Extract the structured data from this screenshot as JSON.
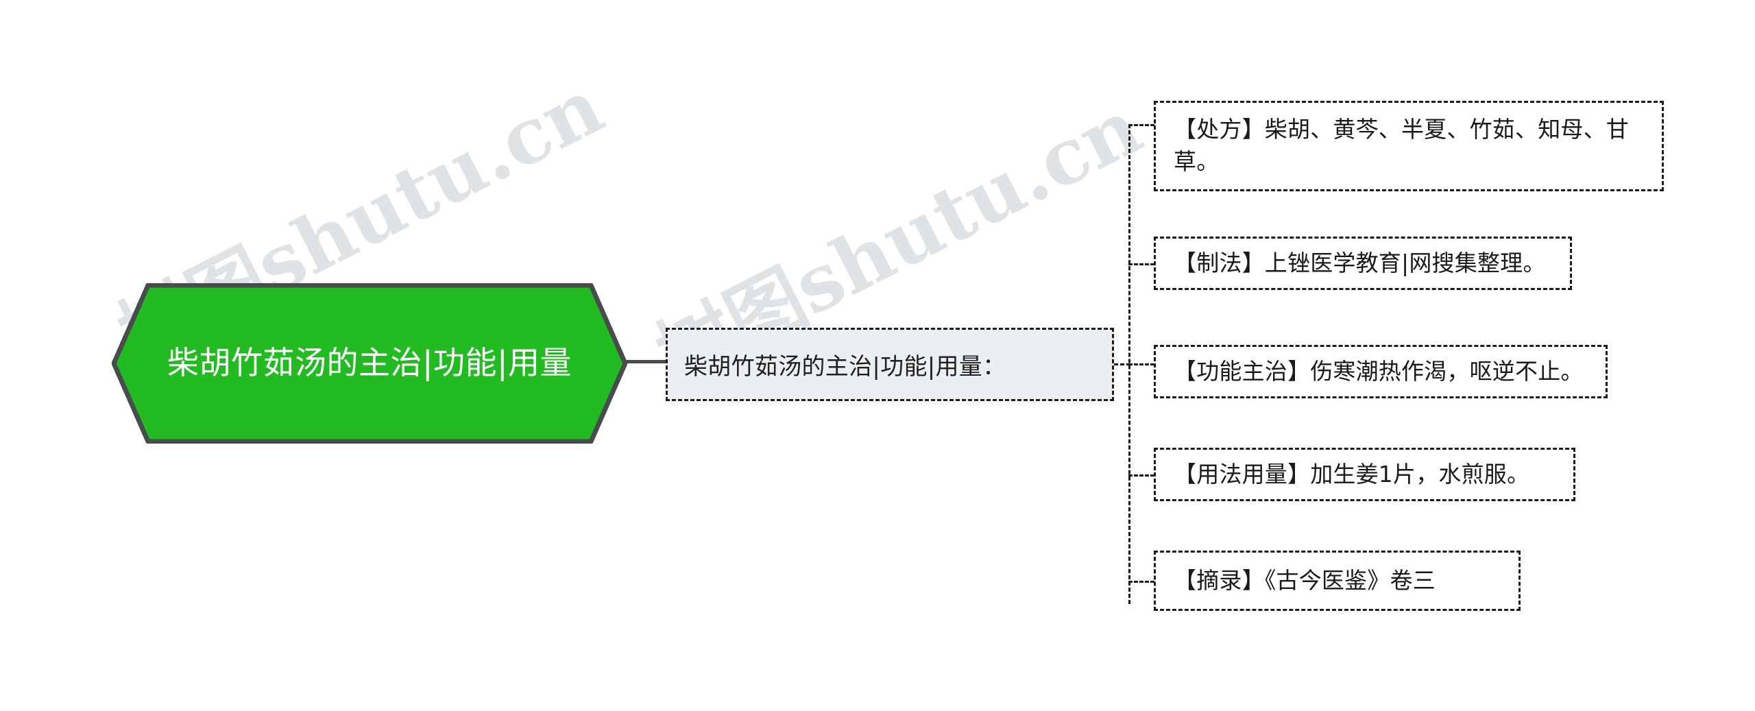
{
  "diagram": {
    "type": "mind-map",
    "watermark": "树图shutu.cn",
    "colors": {
      "root_fill": "#22bb22",
      "root_border": "#474d4d",
      "root_text": "#ffffff",
      "mid_fill": "#eceff1",
      "node_border": "#1c1c1c",
      "node_text": "#1a1a1a",
      "watermark": "#cdd2d8",
      "background": "#ffffff"
    },
    "root": {
      "label": "柴胡竹茹汤的主治|功能|用量"
    },
    "mid": {
      "label": "柴胡竹茹汤的主治|功能|用量："
    },
    "leaves": [
      {
        "label": "【处方】柴胡、黄芩、半夏、竹茹、知母、甘草。"
      },
      {
        "label": "【制法】上锉医学教育|网搜集整理。"
      },
      {
        "label": "【功能主治】伤寒潮热作渴，呕逆不止。"
      },
      {
        "label": "【用法用量】加生姜1片，水煎服。"
      },
      {
        "label": "【摘录】《古今医鉴》卷三"
      }
    ]
  }
}
